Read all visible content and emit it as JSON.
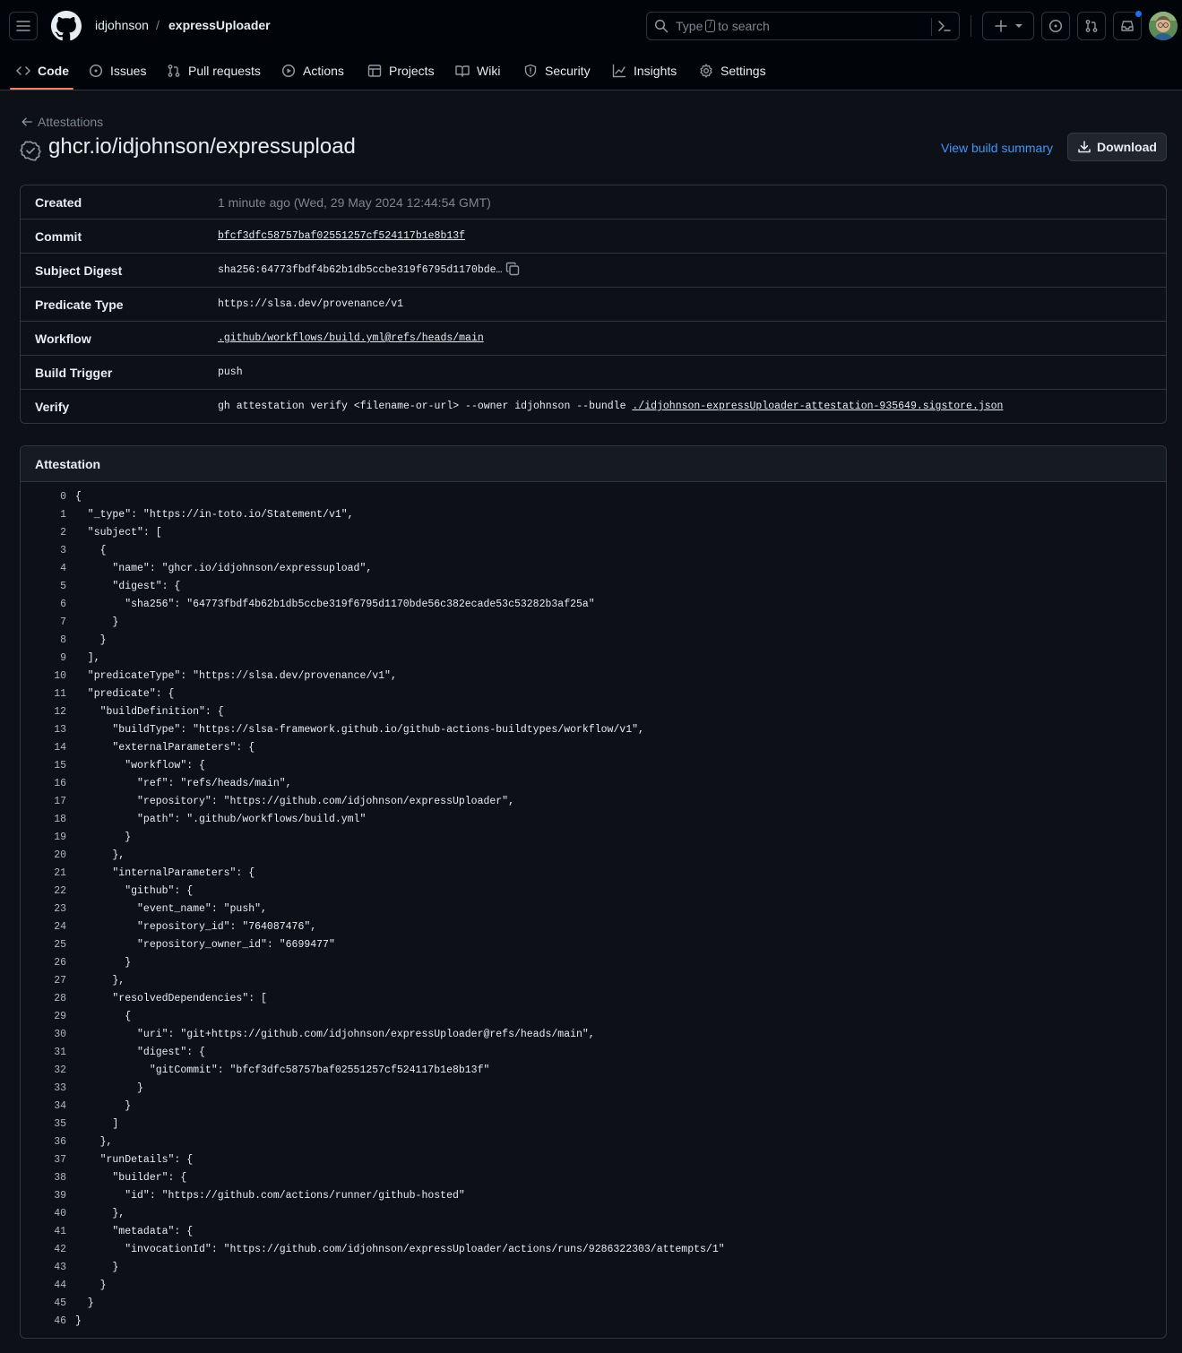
{
  "repo": {
    "owner": "idjohnson",
    "separator": "/",
    "name": "expressUploader"
  },
  "search": {
    "prefix": "Type",
    "key": "/",
    "suffix": "to search"
  },
  "nav": [
    {
      "label": "Code"
    },
    {
      "label": "Issues"
    },
    {
      "label": "Pull requests"
    },
    {
      "label": "Actions"
    },
    {
      "label": "Projects"
    },
    {
      "label": "Wiki"
    },
    {
      "label": "Security"
    },
    {
      "label": "Insights"
    },
    {
      "label": "Settings"
    }
  ],
  "page": {
    "back_label": "Attestations",
    "title": "ghcr.io/idjohnson/expressupload",
    "view_summary": "View build summary",
    "download": "Download"
  },
  "details": {
    "created": {
      "label": "Created",
      "value": "1 minute ago (Wed, 29 May 2024 12:44:54 GMT)"
    },
    "commit": {
      "label": "Commit",
      "value": "bfcf3dfc58757baf02551257cf524117b1e8b13f"
    },
    "digest": {
      "label": "Subject Digest",
      "value": "sha256:64773fbdf4b62b1db5ccbe319f6795d1170bde…"
    },
    "predicate": {
      "label": "Predicate Type",
      "value": "https://slsa.dev/provenance/v1"
    },
    "workflow": {
      "label": "Workflow",
      "value": ".github/workflows/build.yml@refs/heads/main"
    },
    "trigger": {
      "label": "Build Trigger",
      "value": "push"
    },
    "verify": {
      "label": "Verify",
      "command": "gh attestation verify <filename-or-url> --owner idjohnson --bundle ",
      "bundle": "./idjohnson-expressUploader-attestation-935649.sigstore.json"
    }
  },
  "attestation": {
    "heading": "Attestation",
    "lines": [
      "{",
      "  \"_type\": \"https://in-toto.io/Statement/v1\",",
      "  \"subject\": [",
      "    {",
      "      \"name\": \"ghcr.io/idjohnson/expressupload\",",
      "      \"digest\": {",
      "        \"sha256\": \"64773fbdf4b62b1db5ccbe319f6795d1170bde56c382ecade53c53282b3af25a\"",
      "      }",
      "    }",
      "  ],",
      "  \"predicateType\": \"https://slsa.dev/provenance/v1\",",
      "  \"predicate\": {",
      "    \"buildDefinition\": {",
      "      \"buildType\": \"https://slsa-framework.github.io/github-actions-buildtypes/workflow/v1\",",
      "      \"externalParameters\": {",
      "        \"workflow\": {",
      "          \"ref\": \"refs/heads/main\",",
      "          \"repository\": \"https://github.com/idjohnson/expressUploader\",",
      "          \"path\": \".github/workflows/build.yml\"",
      "        }",
      "      },",
      "      \"internalParameters\": {",
      "        \"github\": {",
      "          \"event_name\": \"push\",",
      "          \"repository_id\": \"764087476\",",
      "          \"repository_owner_id\": \"6699477\"",
      "        }",
      "      },",
      "      \"resolvedDependencies\": [",
      "        {",
      "          \"uri\": \"git+https://github.com/idjohnson/expressUploader@refs/heads/main\",",
      "          \"digest\": {",
      "            \"gitCommit\": \"bfcf3dfc58757baf02551257cf524117b1e8b13f\"",
      "          }",
      "        }",
      "      ]",
      "    },",
      "    \"runDetails\": {",
      "      \"builder\": {",
      "        \"id\": \"https://github.com/actions/runner/github-hosted\"",
      "      },",
      "      \"metadata\": {",
      "        \"invocationId\": \"https://github.com/idjohnson/expressUploader/actions/runs/9286322303/attempts/1\"",
      "      }",
      "    }",
      "  }",
      "}"
    ]
  }
}
